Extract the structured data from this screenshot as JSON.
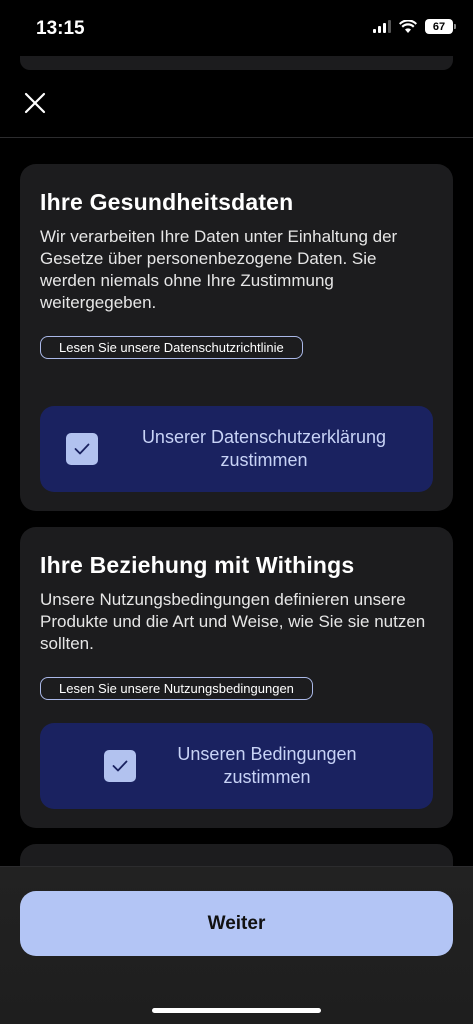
{
  "status_bar": {
    "time": "13:15",
    "battery": "67",
    "icons": [
      "signal-icon",
      "wifi-icon",
      "battery-icon"
    ]
  },
  "header": {
    "close_icon": "close-icon"
  },
  "health_data": {
    "title": "Ihre Gesundheitsdaten",
    "text": "Wir verarbeiten Ihre Daten unter Einhaltung der Gesetze über personenbezogene Daten. Sie werden niemals ohne Ihre Zustimmung weitergegeben.",
    "link_label": "Lesen Sie unsere Datenschutzrichtlinie",
    "consent_label": "Unserer Datenschutzerklärung zustimmen",
    "consent_checked": true
  },
  "relationship": {
    "title": "Ihre Beziehung mit Withings",
    "text": "Unsere Nutzungsbedingungen definieren unsere Produkte und die Art und Weise, wie Sie sie nutzen sollten.",
    "link_label": "Lesen Sie unsere Nutzungsbedingungen",
    "consent_label": "Unseren Bedingungen zustimmen",
    "consent_checked": true
  },
  "footer": {
    "continue_label": "Weiter"
  },
  "colors": {
    "background": "#000000",
    "card": "#1c1c1e",
    "consent_box": "#1a2260",
    "checkbox": "#b2c2ef",
    "primary_button": "#b3c5f5",
    "link_border": "#aab8e8"
  }
}
